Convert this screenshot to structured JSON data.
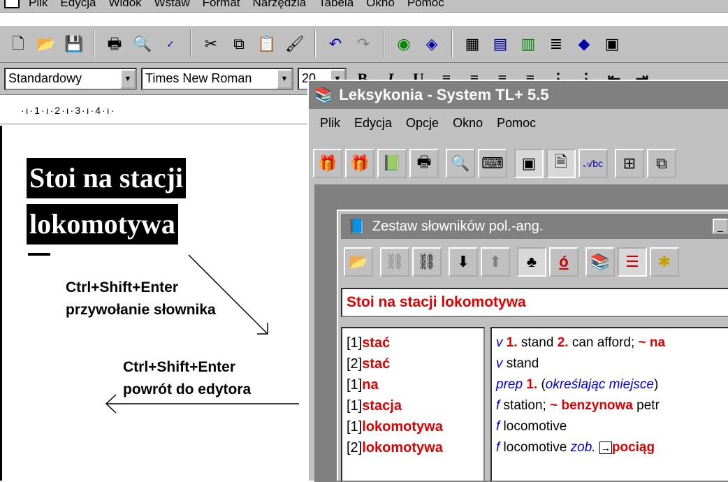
{
  "word": {
    "menu": [
      "Plik",
      "Edycja",
      "Widok",
      "Wstaw",
      "Format",
      "Narzędzia",
      "Tabela",
      "Okno",
      "Pomoc"
    ],
    "style_combo": "Standardowy",
    "font_combo": "Times New Roman",
    "size_combo": "20",
    "ruler_text": "·ı·1·ı·2·ı·3·ı·4·ı·",
    "headline_line1": "Stoi na stacji",
    "headline_line2": "lokomotywa"
  },
  "annotations": {
    "note1_line1": "Ctrl+Shift+Enter",
    "note1_line2": "przywołanie słownika",
    "note2_line1": "Ctrl+Shift+Enter",
    "note2_line2": "powrót do edytora"
  },
  "leksykonia": {
    "title": "Leksykonia - System TL+ 5.5",
    "menu": [
      "Plik",
      "Edycja",
      "Opcje",
      "Okno",
      "Pomoc"
    ]
  },
  "zestaw": {
    "title": "Zestaw słowników pol.-ang.",
    "query": "Stoi na stacji lokomotywa",
    "entries": [
      {
        "num": "[1]",
        "word": "stać"
      },
      {
        "num": "[2]",
        "word": "stać"
      },
      {
        "num": "[1]",
        "word": "na"
      },
      {
        "num": "[1]",
        "word": "stacja"
      },
      {
        "num": "[1]",
        "word": "lokomotywa"
      },
      {
        "num": "[2]",
        "word": "lokomotywa"
      }
    ],
    "defs": [
      {
        "pos": "v",
        "a": "1.",
        "b": " stand ",
        "c": "2.",
        "d": " can afford; ",
        "e": "~ na"
      },
      {
        "pos": "v",
        "b": " stand"
      },
      {
        "pos": "prep",
        "a": "1.",
        "b": " (",
        "i": "określając miejsce",
        "d": ")"
      },
      {
        "pos": "f",
        "b": " station; ",
        "e": "~ benzynowa",
        "d": " petr"
      },
      {
        "pos": "f",
        "b": " locomotive"
      },
      {
        "pos": "f",
        "b": " locomotive ",
        "i": "zob.",
        "e": "pociąg"
      }
    ]
  },
  "colors": {
    "accent_red": "#e00000",
    "link_blue": "#0000ee",
    "chrome": "#c0c0c0"
  }
}
